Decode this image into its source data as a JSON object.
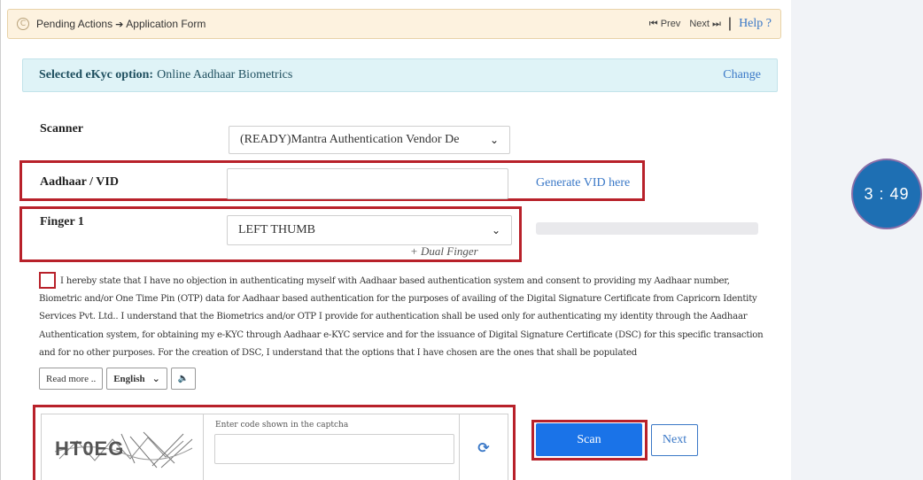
{
  "header": {
    "breadcrumb_start": "Pending Actions",
    "breadcrumb_end": "Application Form",
    "prev_label": "Prev",
    "next_label": "Next",
    "help_label": "Help ?"
  },
  "ekyc": {
    "label": "Selected eKyc option:",
    "value": "Online Aadhaar Biometrics",
    "change_label": "Change"
  },
  "form": {
    "scanner_label": "Scanner",
    "scanner_value": "(READY)Mantra Authentication Vendor De",
    "aadhaar_label": "Aadhaar / VID",
    "aadhaar_value": "",
    "generate_vid_label": "Generate VID here",
    "finger_label": "Finger 1",
    "finger_value": "LEFT THUMB",
    "dual_finger_label": "+ Dual Finger",
    "scan_progress": 0
  },
  "consent": {
    "checked": false,
    "text": "I hereby state that I have no objection in authenticating myself with Aadhaar based authentication system and consent to providing my Aadhaar number, Biometric and/or One Time Pin (OTP) data for Aadhaar based authentication for the purposes of availing of the Digital Signature Certificate from Capricorn Identity Services Pvt. Ltd.. I understand that the Biometrics and/or OTP I provide for authentication shall be used only for authenticating my identity through the Aadhaar Authentication system, for obtaining my e-KYC through Aadhaar e-KYC service and for the issuance of Digital Signature Certificate (DSC) for this specific transaction and for no other purposes. For the creation of DSC, I understand that the options that I have chosen are the ones that shall be populated",
    "read_more_label": "Read more ..",
    "language_value": "English"
  },
  "captcha": {
    "code": "HT0EG",
    "hint": "Enter code shown in the captcha",
    "input_value": ""
  },
  "actions": {
    "scan_label": "Scan",
    "next_label": "Next"
  },
  "timer": {
    "value": "3 : 49"
  },
  "icons": {
    "brand": "copyright-icon",
    "breadcrumb_arrow": "arrow-right-icon",
    "prev": "double-left-icon",
    "next": "double-right-icon",
    "select": "chevron-down-icon",
    "speaker": "speaker-icon",
    "refresh": "refresh-icon"
  },
  "colors": {
    "accent": "#1a73e8",
    "link": "#3a78c7",
    "highlight": "#b8212a",
    "timer": "#1e6fb3",
    "breadcrumb_bg": "#fdf2df",
    "ekyc_bg": "#dff3f7"
  }
}
